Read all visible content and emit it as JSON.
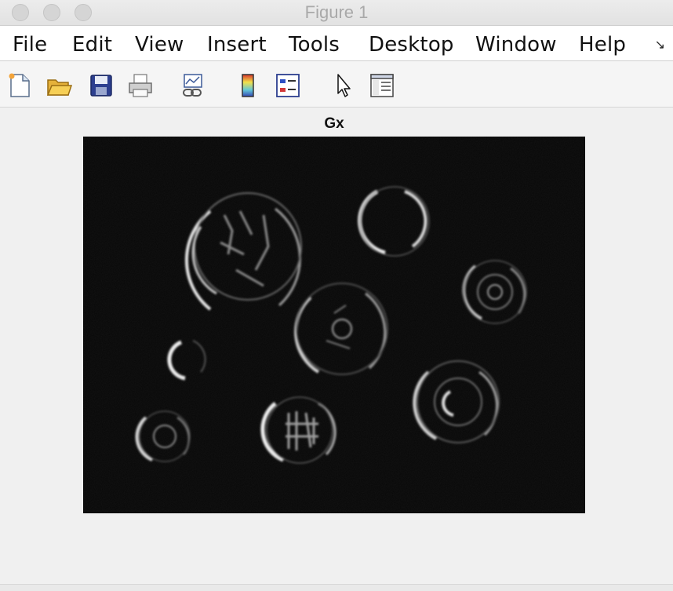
{
  "window": {
    "title": "Figure 1"
  },
  "menu": {
    "items": [
      "File",
      "Edit",
      "View",
      "Insert",
      "Tools",
      "Desktop",
      "Window",
      "Help"
    ],
    "overflow": "↘"
  },
  "toolbar": {
    "icons": [
      "new-figure-icon",
      "open-file-icon",
      "save-icon",
      "print-icon",
      "link-plot-icon",
      "insert-colorbar-icon",
      "insert-legend-icon",
      "edit-plot-pointer-icon",
      "show-plot-tools-icon"
    ]
  },
  "axes": {
    "title": "Gx"
  },
  "colors": {
    "plot_background": "#070707",
    "edge_highlight": "#d8d8d8"
  }
}
